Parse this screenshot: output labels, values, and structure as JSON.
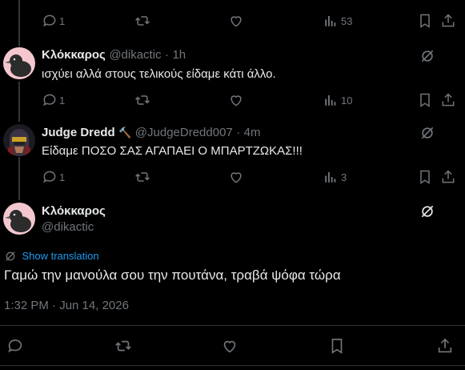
{
  "reply0": {
    "reply_count": "1",
    "views": "53"
  },
  "reply1": {
    "name": "Κλόκκαρος",
    "handle": "@dikactic",
    "dot": "·",
    "time": "1h",
    "text": "ισχύει αλλά στους τελικούς είδαμε κάτι άλλο.",
    "reply_count": "1",
    "views": "10"
  },
  "reply2": {
    "name": "Judge Dredd",
    "badge": "🔨",
    "handle": "@JudgeDredd007",
    "dot": "·",
    "time": "4m",
    "text": "Είδαμε ΠΟΣΟ ΣΑΣ ΑΓΑΠΑΕΙ Ο ΜΠΑΡΤΖΩΚΑΣ!!!",
    "reply_count": "1",
    "views": "3"
  },
  "main": {
    "name": "Κλόκκαρος",
    "handle": "@dikactic",
    "show_translation": "Show translation",
    "text": "Γαμώ την μανούλα σου την πουτάνα, τραβά ψόφα τώρα",
    "timestamp": "1:32 PM · Jun 14, 2026"
  },
  "colors": {
    "background": "#000000",
    "text": "#e7e9ea",
    "muted": "#71767b",
    "link": "#1d9bf0",
    "divider": "#2f3336"
  }
}
